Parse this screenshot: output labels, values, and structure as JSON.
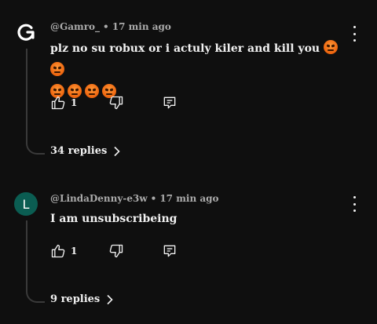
{
  "comments": [
    {
      "avatar_letter": "",
      "author": "@Gamro_",
      "separator": "•",
      "time": "17 min ago",
      "text_line1": "plz no su robux or i actuly kiler and kill you",
      "like_count": "1",
      "replies_label": "34 replies",
      "avatar_icon": "refresh-logo-icon"
    },
    {
      "avatar_letter": "L",
      "author": "@LindaDenny-e3w",
      "separator": "•",
      "time": "17 min ago",
      "text_line1": "I am unsubscribeing",
      "like_count": "1",
      "replies_label": "9 replies",
      "avatar_color": "#0b5d52"
    }
  ],
  "icons": [
    "thumbs-up-icon",
    "thumbs-down-icon",
    "reply-icon",
    "more-vert-icon",
    "chevron-right-icon",
    "angry-face-emoji"
  ],
  "colors": {
    "background": "#0f0f0f",
    "text": "#f1f1f1",
    "meta": "#aaaaaa",
    "emoji": "#f06a12"
  }
}
